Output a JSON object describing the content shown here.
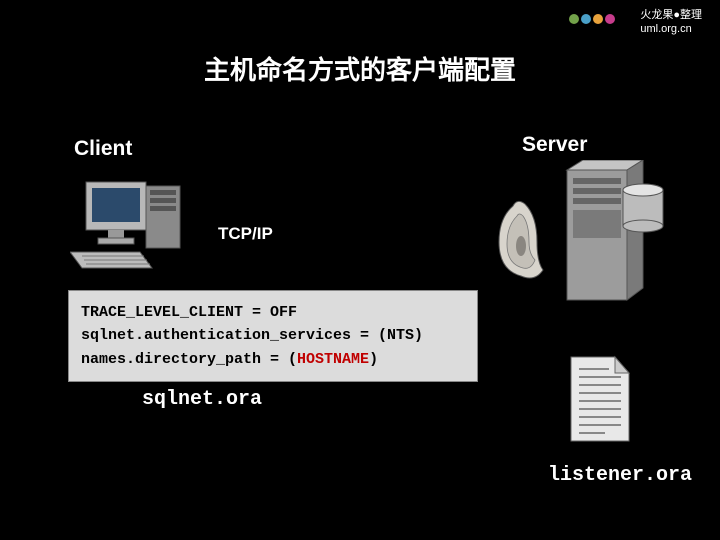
{
  "logo": {
    "line1": "火龙果●整理",
    "line2": "uml.org.cn"
  },
  "title": "主机命名方式的客户端配置",
  "labels": {
    "client": "Client",
    "server": "Server",
    "tcpip": "TCP/IP",
    "sqlnet_ora": "sqlnet.ora",
    "listener_ora": "listener.ora"
  },
  "config": {
    "line1_a": "TRACE_LEVEL_CLIENT = OFF",
    "line2_a": "sqlnet.authentication_services = (NTS)",
    "line3_a": "names.directory_path = (",
    "line3_red": "HOSTNAME",
    "line3_b": ")"
  },
  "colors": {
    "dot1": "#73a24a",
    "dot2": "#4aa0c8",
    "dot3": "#e8a23c",
    "dot4": "#c73c8c",
    "dot5": "#000"
  }
}
